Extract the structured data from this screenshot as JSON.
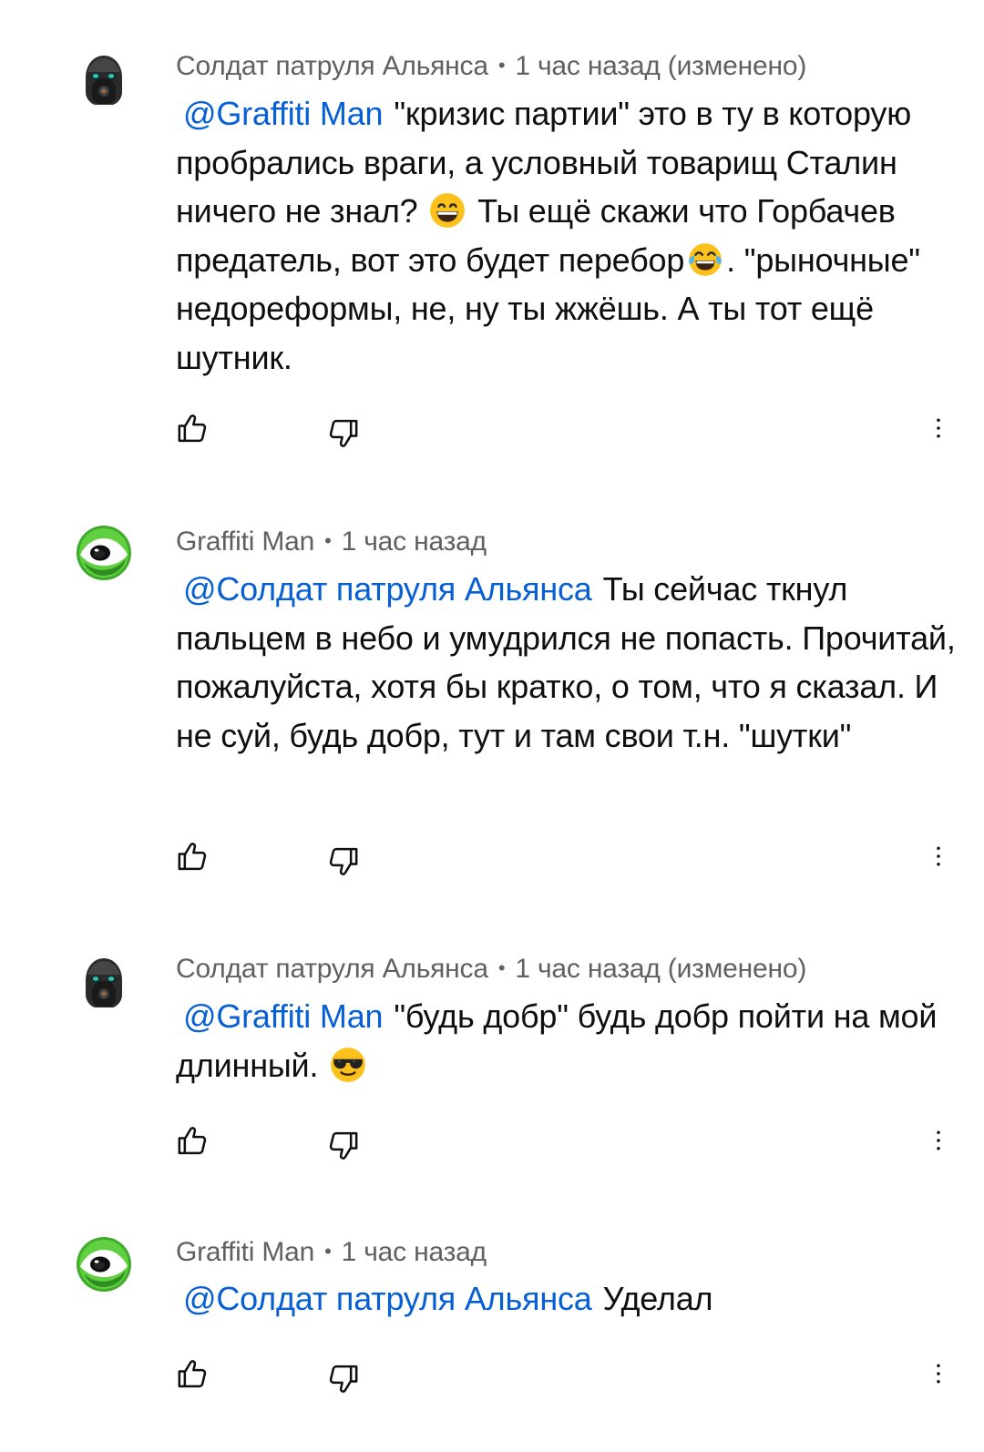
{
  "comments": [
    {
      "author": "Солдат патруля Альянса",
      "separator": "•",
      "time": "1 час назад (изменено)",
      "mention": "@Graffiti Man",
      "text_parts": [
        "\"кризис партии\" это в ту в которую пробрались враги, а условный товарищ Сталин ничего не знал?",
        "Ты ещё скажи что Горбачев предатель, вот это будет перебор",
        ". \"рыночные\" недореформы, не, ну ты жжёшь. А ты тот ещё шутник."
      ],
      "emojis": [
        "grinning-smile-emoji",
        "tears-of-joy-emoji"
      ],
      "avatar_icon": "gas-mask-soldier-avatar"
    },
    {
      "author": "Graffiti Man",
      "separator": "•",
      "time": "1 час назад",
      "mention": "@Солдат патруля Альянса",
      "text_parts": [
        "Ты сейчас ткнул пальцем в небо и умудрился не попасть. Прочитай, пожалуйста, хотя бы кратко, о том, что я сказал. И не суй, будь добр, тут и там свои т.н. \"шутки\""
      ],
      "avatar_icon": "green-eye-avatar"
    },
    {
      "author": "Солдат патруля Альянса",
      "separator": "•",
      "time": "1 час назад (изменено)",
      "mention": "@Graffiti Man",
      "text_parts": [
        "\"будь добр\" будь добр пойти на мой длинный."
      ],
      "emojis": [
        "sunglasses-emoji"
      ],
      "avatar_icon": "gas-mask-soldier-avatar"
    },
    {
      "author": "Graffiti Man",
      "separator": "•",
      "time": "1 час назад",
      "mention": "@Солдат патруля Альянса",
      "text_parts": [
        "Уделал"
      ],
      "avatar_icon": "green-eye-avatar"
    }
  ],
  "icons": {
    "like": "thumbs-up-icon",
    "dislike": "thumbs-down-icon",
    "more": "more-vertical-icon"
  },
  "colors": {
    "mention": "#065fd4",
    "meta": "#606060",
    "text": "#0f0f0f"
  }
}
